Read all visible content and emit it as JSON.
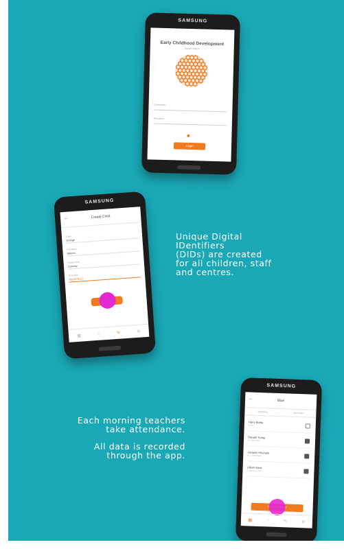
{
  "colors": {
    "background": "#1aa8b6",
    "accent": "#f07a20",
    "touch": "#e628d2"
  },
  "phones": {
    "login": {
      "brand": "SAMSUNG",
      "title": "Early Childhood Development",
      "subtitle": "Social Reform",
      "username_label": "Username",
      "password_label": "Password",
      "login_button": "Login"
    },
    "create_child": {
      "brand": "SAMSUNG",
      "title": "Create Child",
      "fields": [
        {
          "label": "Class",
          "value": "Orange"
        },
        {
          "label": "First Name",
          "value": "Alberto"
        },
        {
          "label": "Family Name",
          "value": "Conway"
        },
        {
          "label": "ID Number",
          "value": "0893978231"
        }
      ],
      "nav_label": "Create"
    },
    "attendance": {
      "brand": "SAMSUNG",
      "title": "Blue",
      "tabs": [
        "Attendance",
        "All Present"
      ],
      "children": [
        {
          "name": "Harry Botha",
          "id": "ID 412",
          "checked": false
        },
        {
          "name": "Donald Trump",
          "id": "ID 7689 31882",
          "checked": true
        },
        {
          "name": "Jacques Khumalo",
          "id": "ID 12 0000000001",
          "checked": true
        },
        {
          "name": "Lilliam Gatsi",
          "id": "ID 0000 10 2 2928",
          "checked": true
        }
      ],
      "submit_button": "Take Attendance",
      "nav_label": "Attendance"
    }
  },
  "captions": {
    "dids": [
      "Unique Digital",
      "IDentifiers",
      "(DIDs) are created",
      "for all children, staff",
      "and centres."
    ],
    "attendance_1": [
      "Each morning teachers",
      "take attendance."
    ],
    "attendance_2": [
      "All data is recorded",
      "through the app."
    ]
  }
}
